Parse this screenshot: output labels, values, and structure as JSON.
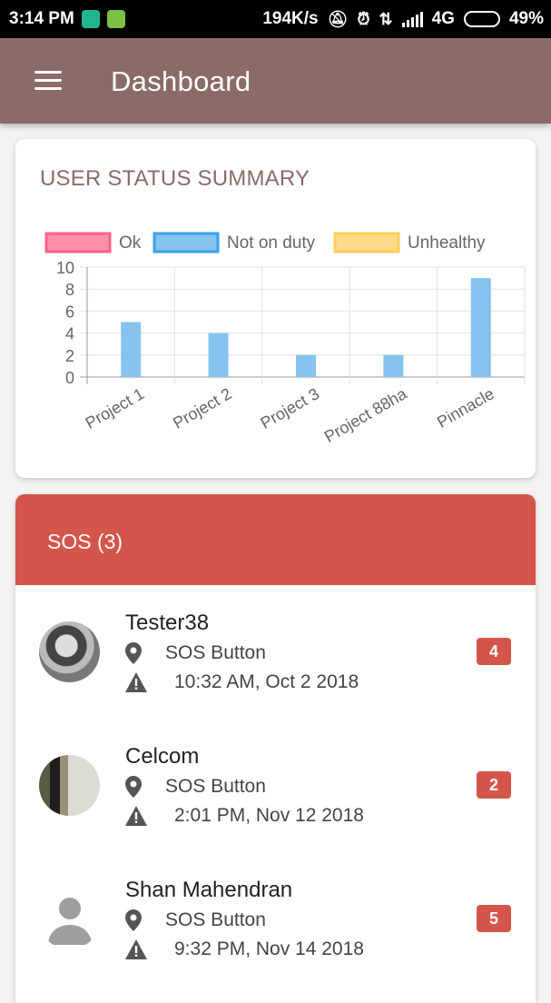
{
  "status_bar": {
    "time": "3:14 PM",
    "speed": "194K/s",
    "network": "4G",
    "battery": "49%",
    "battery_level": 0.49,
    "icons": [
      "shield-app-icon",
      "android-app-icon",
      "mute-icon",
      "alarm-icon",
      "data-arrows-icon",
      "signal-icon",
      "battery-icon"
    ]
  },
  "app_bar": {
    "title": "Dashboard",
    "color": "#8a6b67"
  },
  "summary_card": {
    "title": "USER STATUS SUMMARY"
  },
  "chart_data": {
    "type": "bar",
    "title": "",
    "categories": [
      "Project 1",
      "Project 2",
      "Project 3",
      "Project 88ha",
      "Pinnacle"
    ],
    "series": [
      {
        "name": "Ok",
        "values": [
          0,
          0,
          0,
          0,
          0
        ],
        "color": "#ff8fa8",
        "border": "#ff6384"
      },
      {
        "name": "Not on duty",
        "values": [
          5,
          4,
          2,
          2,
          9
        ],
        "color": "#86c3ef",
        "border": "#36a2eb"
      },
      {
        "name": "Unhealthy",
        "values": [
          0,
          0,
          0,
          0,
          0
        ],
        "color": "#ffda8a",
        "border": "#ffce56"
      }
    ],
    "yticks": [
      "10",
      "8",
      "6",
      "4",
      "2",
      "0"
    ],
    "ylim": [
      0,
      10
    ],
    "grid": true,
    "legend_position": "top"
  },
  "sos": {
    "title": "SOS (3)",
    "color": "#d4554a",
    "items": [
      {
        "name": "Tester38",
        "type": "SOS Button",
        "time": "10:32 AM, Oct 2 2018",
        "count": "4"
      },
      {
        "name": "Celcom",
        "type": "SOS Button",
        "time": "2:01 PM, Nov 12 2018",
        "count": "2"
      },
      {
        "name": "Shan Mahendran",
        "type": "SOS Button",
        "time": "9:32 PM, Nov 14 2018",
        "count": "5"
      }
    ]
  }
}
